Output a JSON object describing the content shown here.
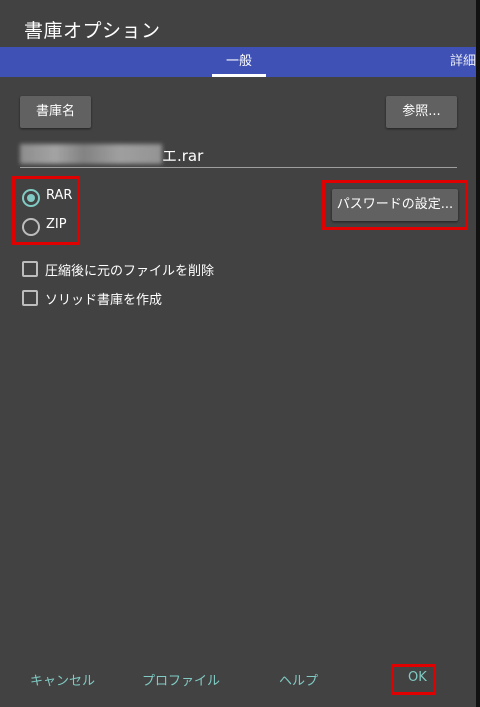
{
  "dialog": {
    "title": "書庫オプション"
  },
  "tabs": [
    {
      "label": "一般",
      "active": true
    },
    {
      "label": "詳細",
      "active": false
    }
  ],
  "archive_name_button": "書庫名",
  "browse_button": "参照...",
  "filename": {
    "visible_suffix": "エ.rar"
  },
  "format": {
    "options": [
      {
        "label": "RAR",
        "selected": true
      },
      {
        "label": "ZIP",
        "selected": false
      }
    ]
  },
  "password_button": "パスワードの設定...",
  "options": [
    {
      "label": "圧縮後に元のファイルを削除",
      "checked": false
    },
    {
      "label": "ソリッド書庫を作成",
      "checked": false
    }
  ],
  "footer": {
    "cancel": "キャンセル",
    "profile": "プロファイル",
    "help": "ヘルプ",
    "ok": "OK"
  },
  "colors": {
    "dialog_bg": "#424242",
    "tab_bar": "#3f51b5",
    "accent": "#80cbc4",
    "highlight": "#e00000"
  }
}
